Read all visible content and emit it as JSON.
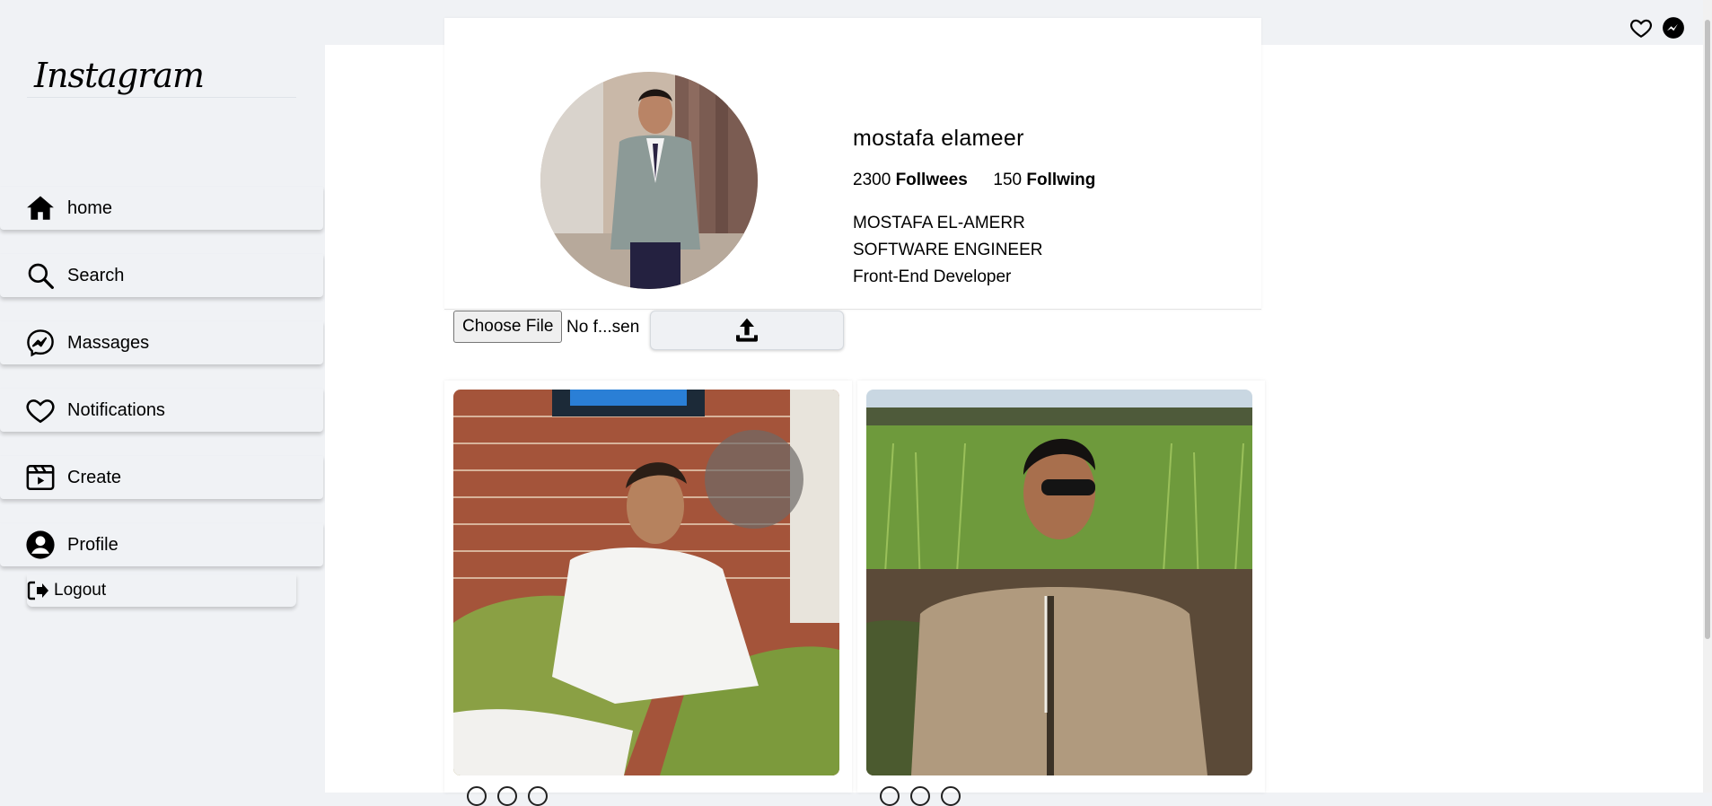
{
  "app": {
    "logo": "Instagram"
  },
  "topbar": {
    "icons": [
      "heart-icon",
      "messenger-icon"
    ]
  },
  "sidebar": {
    "items": [
      {
        "label": "home",
        "icon": "home-icon"
      },
      {
        "label": "Search",
        "icon": "search-icon"
      },
      {
        "label": "Massages",
        "icon": "messenger-icon"
      },
      {
        "label": "Notifications",
        "icon": "heart-icon"
      },
      {
        "label": "Create",
        "icon": "clapperboard-icon"
      },
      {
        "label": "Profile",
        "icon": "user-circle-icon"
      }
    ],
    "logout_label": "Logout"
  },
  "profile": {
    "username": "mostafa elameer",
    "followees_count": "2300",
    "followees_label": "Follwees",
    "following_count": "150",
    "following_label": "Follwing",
    "bio": [
      "MOSTAFA EL-AMERR",
      "SOFTWARE ENGINEER",
      "Front-End Developer"
    ]
  },
  "upload": {
    "choose_file_label": "Choose File",
    "file_status": "No f...sen",
    "upload_icon": "upload-icon"
  },
  "posts": [
    {
      "icon": "photo-man-sitting-on-couch"
    },
    {
      "icon": "photo-man-in-field-sunglasses"
    }
  ],
  "colors": {
    "sidebar_bg": "#f0f2f5",
    "main_bg": "#ffffff",
    "text": "#000000"
  }
}
